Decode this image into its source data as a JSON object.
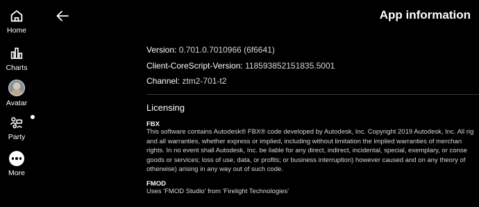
{
  "sidebar": {
    "items": [
      {
        "label": "Home",
        "icon": "home-icon"
      },
      {
        "label": "Charts",
        "icon": "charts-icon"
      },
      {
        "label": "Avatar",
        "icon": "avatar-image"
      },
      {
        "label": "Party",
        "icon": "party-icon"
      },
      {
        "label": "More",
        "icon": "more-icon"
      }
    ]
  },
  "header": {
    "title": "App information",
    "back_icon": "back-arrow-icon"
  },
  "info": {
    "version_label": "Version:",
    "version_value": "0.701.0.7010966 (6f6641)",
    "corescript_label": "Client-CoreScript-Version:",
    "corescript_value": "118593852151835.5001",
    "channel_label": "Channel:",
    "channel_value": "ztm2-701-t2"
  },
  "licensing": {
    "title": "Licensing",
    "entries": [
      {
        "name": "FBX",
        "lines": [
          "This software contains Autodesk® FBX® code developed by Autodesk, Inc. Copyright 2019 Autodesk, Inc. All rig",
          "and all warranties, whether express or implied, including without limitation the implied warranties of merchan",
          "rights. In no event shall Autodesk, Inc. be liable for any direct, indirect, incidental, special, exemplary, or conse",
          "goods or services; loss of use, data, or profits; or business interruption) however caused and on any theory of",
          "otherwise) arising in any way out of such code."
        ]
      },
      {
        "name": "FMOD",
        "lines": [
          "Uses 'FMOD Studio' from 'Firelight Technologies'"
        ]
      }
    ]
  },
  "colors": {
    "background": "#000000",
    "text": "#ffffff",
    "muted_text": "#d8d8d8",
    "divider": "#3a3a3a"
  }
}
